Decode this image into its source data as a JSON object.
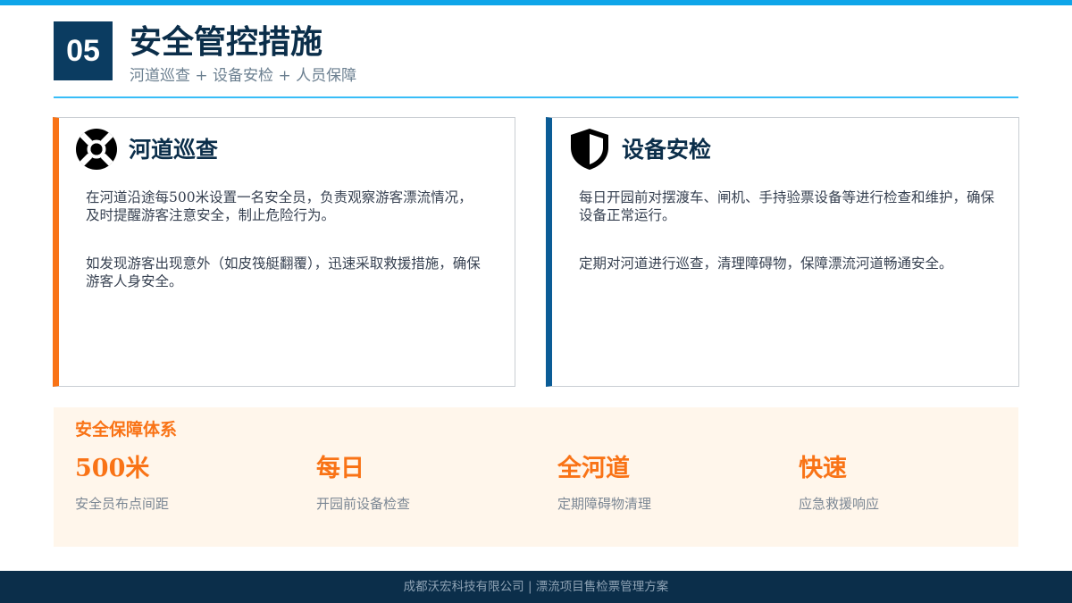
{
  "header": {
    "section_number": "05",
    "title": "安全管控措施",
    "subtitle": "河道巡查 + 设备安检 + 人员保障"
  },
  "cards": [
    {
      "icon": "lifebuoy-icon",
      "title": "河道巡查",
      "paragraphs": [
        "在河道沿途每500米设置一名安全员，负责观察游客漂流情况，及时提醒游客注意安全，制止危险行为。",
        "如发现游客出现意外（如皮筏艇翻覆），迅速采取救援措施，确保游客人身安全。"
      ]
    },
    {
      "icon": "shield-icon",
      "title": "设备安检",
      "paragraphs": [
        "每日开园前对摆渡车、闸机、手持验票设备等进行检查和维护，确保设备正常运行。",
        "定期对河道进行巡查，清理障碍物，保障漂流河道畅通安全。"
      ]
    }
  ],
  "stats": {
    "title": "安全保障体系",
    "items": [
      {
        "value": "500米",
        "label": "安全员布点间距"
      },
      {
        "value": "每日",
        "label": "开园前设备检查"
      },
      {
        "value": "全河道",
        "label": "定期障碍物清理"
      },
      {
        "value": "快速",
        "label": "应急救援响应"
      }
    ]
  },
  "footer": {
    "text": "成都沃宏科技有限公司 | 漂流项目售检票管理方案"
  },
  "colors": {
    "accent_orange": "#F97316",
    "navy": "#0B2E4A",
    "sky_blue": "#0EA5E9",
    "card_right_border": "#0B5C96"
  }
}
